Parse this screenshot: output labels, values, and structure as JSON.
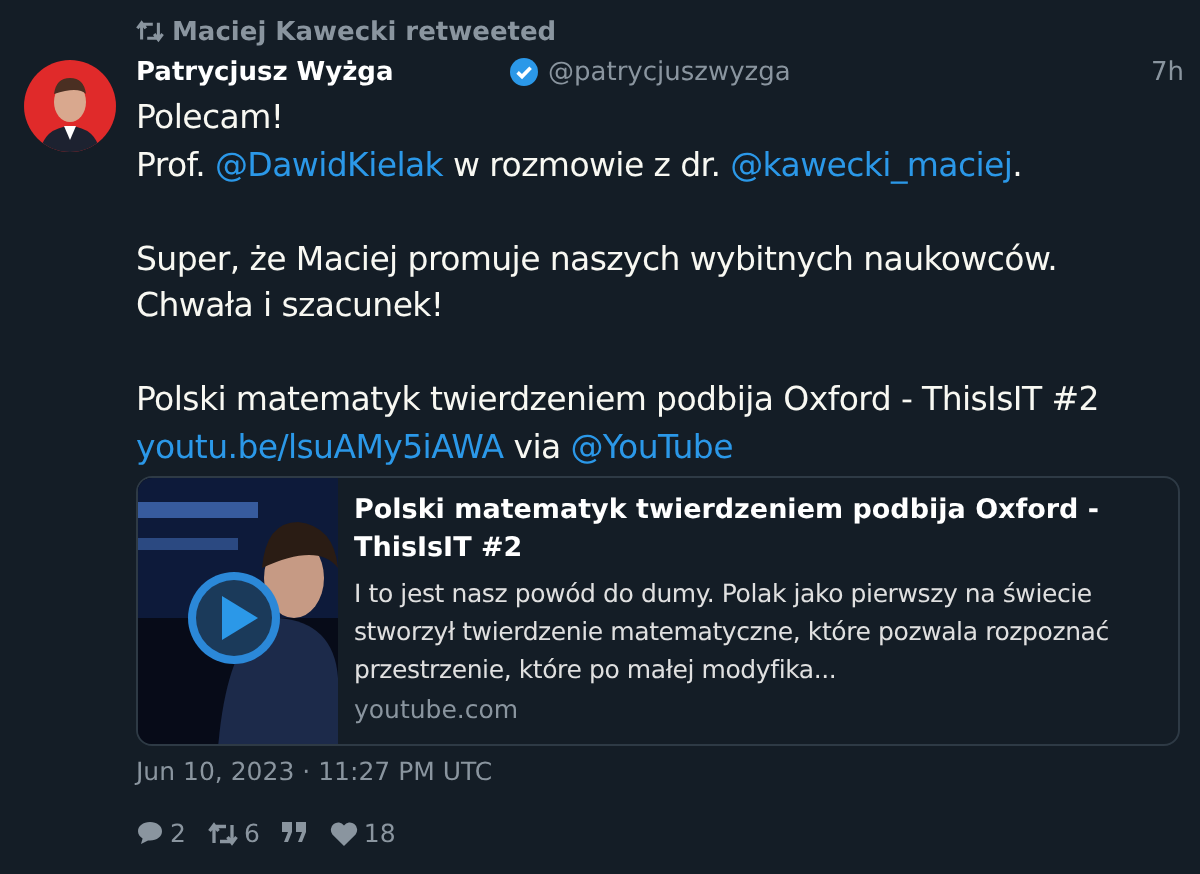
{
  "retweet_header": "Maciej Kawecki retweeted",
  "author": {
    "name": "Patrycjusz Wyżga",
    "verified": true,
    "handle": "@patrycjuszwyzga",
    "time": "7h"
  },
  "body": [
    [
      [
        {
          "kind": "text",
          "text": "Polecam!"
        }
      ],
      [
        {
          "kind": "text",
          "text": "Prof. "
        },
        {
          "kind": "link",
          "text": "@DawidKielak"
        },
        {
          "kind": "text",
          "text": " w rozmowie z dr. "
        },
        {
          "kind": "link",
          "text": "@kawecki_maciej"
        },
        {
          "kind": "text",
          "text": "."
        }
      ]
    ],
    [
      [
        {
          "kind": "text",
          "text": "Super, że Maciej promuje naszych wybitnych naukowców."
        }
      ],
      [
        {
          "kind": "text",
          "text": "Chwała i szacunek!"
        }
      ]
    ],
    [
      [
        {
          "kind": "text",
          "text": "Polski matematyk twierdzeniem podbija Oxford - ThisIsIT #2"
        }
      ],
      [
        {
          "kind": "link",
          "text": "youtu.be/lsuAMy5iAWA"
        },
        {
          "kind": "text",
          "text": " via "
        },
        {
          "kind": "link",
          "text": "@YouTube"
        }
      ]
    ]
  ],
  "card": {
    "title": "Polski matematyk twierdzeniem podbija Oxford - ThisIsIT #2",
    "description": "I to jest nasz powód do dumy. Polak jako pierwszy na świecie stworzył twierdzenie matematyczne, które pozwala rozpoznać przestrzenie, które po małej modyfika...",
    "domain": "youtube.com"
  },
  "date": "Jun 10, 2023 · 11:27 PM UTC",
  "stats": [
    {
      "kind": "reply",
      "count": "2"
    },
    {
      "kind": "retweet",
      "count": "6"
    },
    {
      "kind": "quote"
    },
    {
      "kind": "like",
      "count": "18"
    }
  ]
}
